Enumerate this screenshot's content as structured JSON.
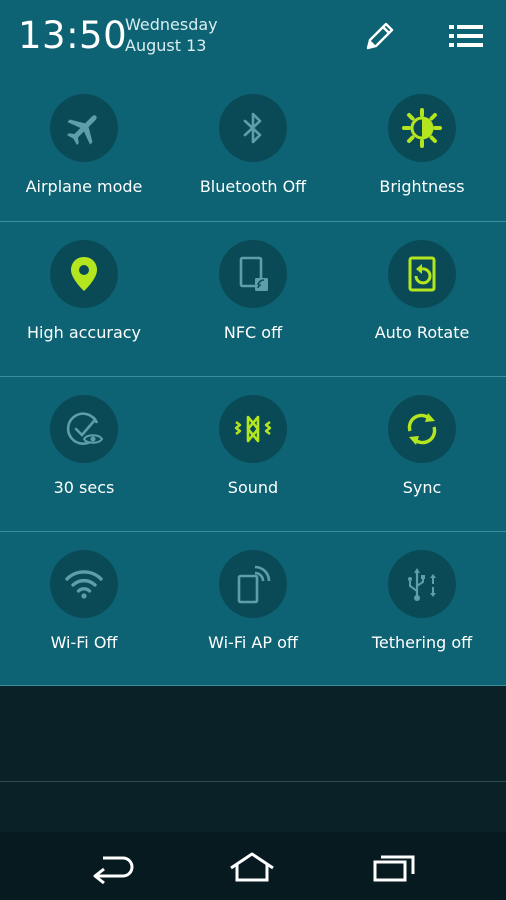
{
  "status": {
    "time": "13:50",
    "weekday": "Wednesday",
    "date": "August 13"
  },
  "header_icons": {
    "edit": "pencil-icon",
    "list": "list-icon"
  },
  "colors": {
    "panel_bg": "#0d6373",
    "tile_circle": "#0a4a57",
    "active": "#b3e61e",
    "inactive": "#5f9da8"
  },
  "rows": [
    {
      "tiles": [
        {
          "label": "Airplane mode",
          "icon": "airplane-icon",
          "active": false
        },
        {
          "label": "Bluetooth Off",
          "icon": "bluetooth-icon",
          "active": false
        },
        {
          "label": "Brightness",
          "icon": "brightness-icon",
          "active": true
        }
      ]
    },
    {
      "tiles": [
        {
          "label": "High accuracy",
          "icon": "location-icon",
          "active": true
        },
        {
          "label": "NFC off",
          "icon": "nfc-icon",
          "active": false
        },
        {
          "label": "Auto Rotate",
          "icon": "auto-rotate-icon",
          "active": true
        }
      ]
    },
    {
      "tiles": [
        {
          "label": "30 secs",
          "icon": "smart-stay-icon",
          "active": false
        },
        {
          "label": "Sound",
          "icon": "sound-vibrate-icon",
          "active": true
        },
        {
          "label": "Sync",
          "icon": "sync-icon",
          "active": true
        }
      ]
    },
    {
      "tiles": [
        {
          "label": "Wi-Fi Off",
          "icon": "wifi-icon",
          "active": false
        },
        {
          "label": "Wi-Fi AP off",
          "icon": "wifi-hotspot-icon",
          "active": false
        },
        {
          "label": "Tethering off",
          "icon": "usb-tethering-icon",
          "active": false
        }
      ]
    }
  ],
  "nav": {
    "back": "back-icon",
    "home": "home-icon",
    "recents": "recent-apps-icon"
  }
}
